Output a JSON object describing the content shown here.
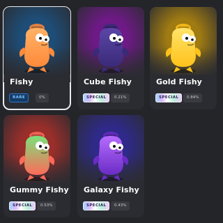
{
  "cards": [
    {
      "name": "Fishy",
      "badge": "RARE",
      "percent": "0%",
      "selected": true,
      "bg_top": "#1e4d77",
      "bg_bottom": "#2b2c31",
      "body": "#ff8a3a",
      "body_light": "#ffb266"
    },
    {
      "name": "Cube Fishy",
      "badge": "SPECIAL",
      "percent": "0.21%",
      "selected": false,
      "bg_top": "#6e1a86",
      "bg_bottom": "#2b2c31",
      "body": "#3a2a78",
      "body_light": "#5b46a8"
    },
    {
      "name": "Gold Fishy",
      "badge": "SPECIAL",
      "percent": "0.84%",
      "selected": false,
      "bg_top": "#a07b12",
      "bg_bottom": "#2b2c31",
      "body": "#ffc21a",
      "body_light": "#ffe36a"
    },
    {
      "name": "Gummy Fishy",
      "badge": "SPECIAL",
      "percent": "0.53%",
      "selected": false,
      "bg_top": "#9a2e2a",
      "bg_bottom": "#2b2c31",
      "body": "#ff6a5a",
      "body_light": "#7be27a"
    },
    {
      "name": "Galaxy Fishy",
      "badge": "SPECIAL",
      "percent": "0.43%",
      "selected": false,
      "bg_top": "#2f2a8a",
      "bg_bottom": "#2b2c31",
      "body": "#6a2cc4",
      "body_light": "#b66bff"
    }
  ]
}
